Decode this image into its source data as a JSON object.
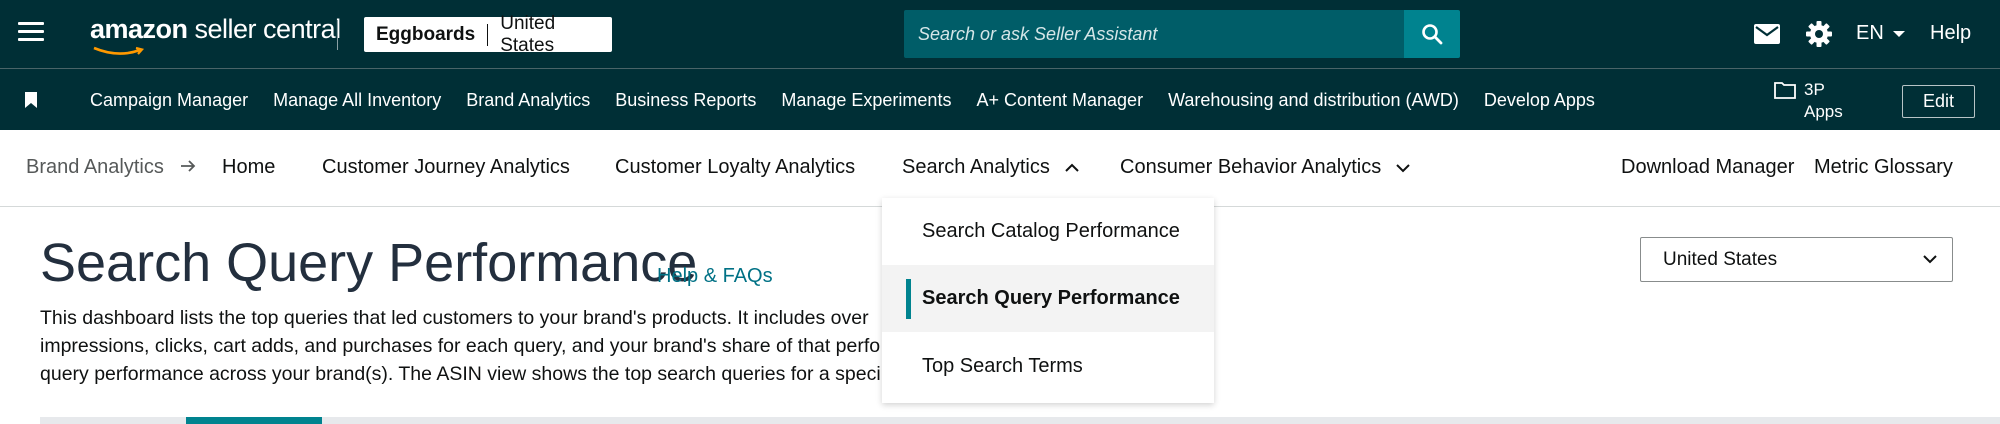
{
  "header": {
    "logo_prefix": "amazon",
    "logo_suffix": " seller central",
    "account_store": "Eggboards",
    "account_marketplace": "United States",
    "search_placeholder": "Search or ask Seller Assistant",
    "language": "EN",
    "help_label": "Help",
    "icons": [
      "menu-icon",
      "search-icon",
      "mail-icon",
      "gear-icon",
      "chevron-down-icon"
    ]
  },
  "bookmarks": {
    "links": [
      "Campaign Manager",
      "Manage All Inventory",
      "Brand Analytics",
      "Business Reports",
      "Manage Experiments",
      "A+ Content Manager",
      "Warehousing and distribution (AWD)",
      "Develop Apps"
    ],
    "apps_label": "3P Apps",
    "edit_label": "Edit"
  },
  "subnav": {
    "breadcrumb": "Brand Analytics",
    "home": "Home",
    "customer_journey": "Customer Journey Analytics",
    "customer_loyalty": "Customer Loyalty Analytics",
    "search_analytics": "Search Analytics",
    "consumer_behavior": "Consumer Behavior Analytics",
    "download_manager": "Download Manager",
    "metric_glossary": "Metric Glossary"
  },
  "search_menu": {
    "items": [
      "Search Catalog Performance",
      "Search Query Performance",
      "Top Search Terms"
    ],
    "active_index": 1
  },
  "page": {
    "title": "Search Query Performance",
    "help_link": "Help & FAQs",
    "description_lines": [
      "This dashboard lists the top queries that led customers to your brand's products. It includes over",
      "impressions, clicks, cart adds, and purchases for each query, and your brand's share of that perfo",
      "query performance across your brand(s). The ASIN view shows the top search queries for a speci"
    ],
    "country_select": "United States"
  },
  "colors": {
    "header_bg": "#002f36",
    "search_bg": "#005d68",
    "search_button": "#00838f",
    "accent": "#00838f",
    "link": "#007185"
  }
}
